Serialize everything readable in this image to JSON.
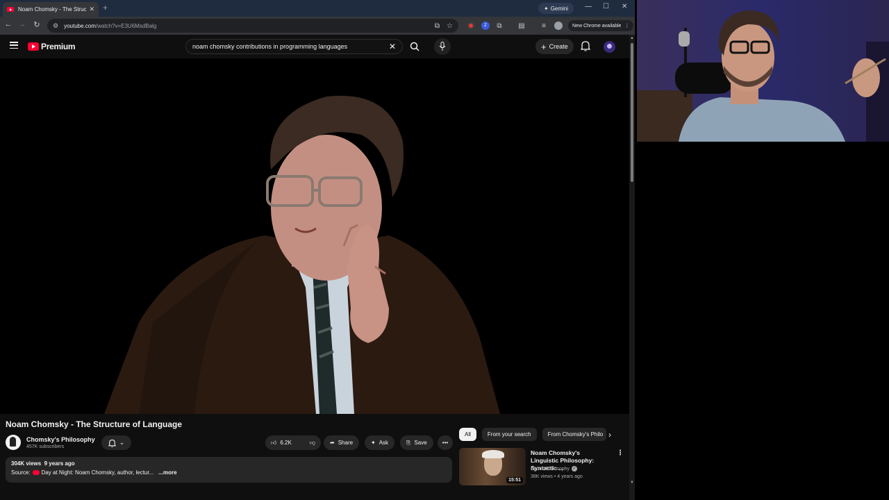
{
  "browser": {
    "tab_title": "Noam Chomsky - The Structure",
    "tab_close": "✕",
    "new_tab": "+",
    "gemini_label": "Gemini",
    "url_host": "youtube.com",
    "url_path": "/watch?v=E3U6MsdBalg",
    "chrome_update": "New Chrome available"
  },
  "youtube": {
    "logo_text": "Premium",
    "search_query": "noam chomsky contributions in programming languages",
    "create_label": "Create"
  },
  "video": {
    "title": "Noam Chomsky - The Structure of Language",
    "channel": "Chomsky's Philosophy",
    "subscribers": "457K subscribers",
    "likes": "6.2K",
    "share_label": "Share",
    "ask_label": "Ask",
    "save_label": "Save",
    "views": "304K views",
    "age": "9 years ago",
    "source_prefix": "Source:",
    "source_text": "Day at Night: Noam Chomsky, author, lectur...",
    "more_label": "...more"
  },
  "sidebar": {
    "chips": [
      "All",
      "From your search",
      "From Chomsky's Philo"
    ],
    "recommendation": {
      "title": "Noam Chomsky's Linguistic Philosophy: Syntactic ...",
      "channel": "Epoch Philosophy",
      "views": "38K views",
      "age": "4 years ago",
      "duration": "15:51"
    }
  },
  "colors": {
    "accent": "#ff0033",
    "background": "#0f0f0f",
    "surface": "#272727"
  }
}
